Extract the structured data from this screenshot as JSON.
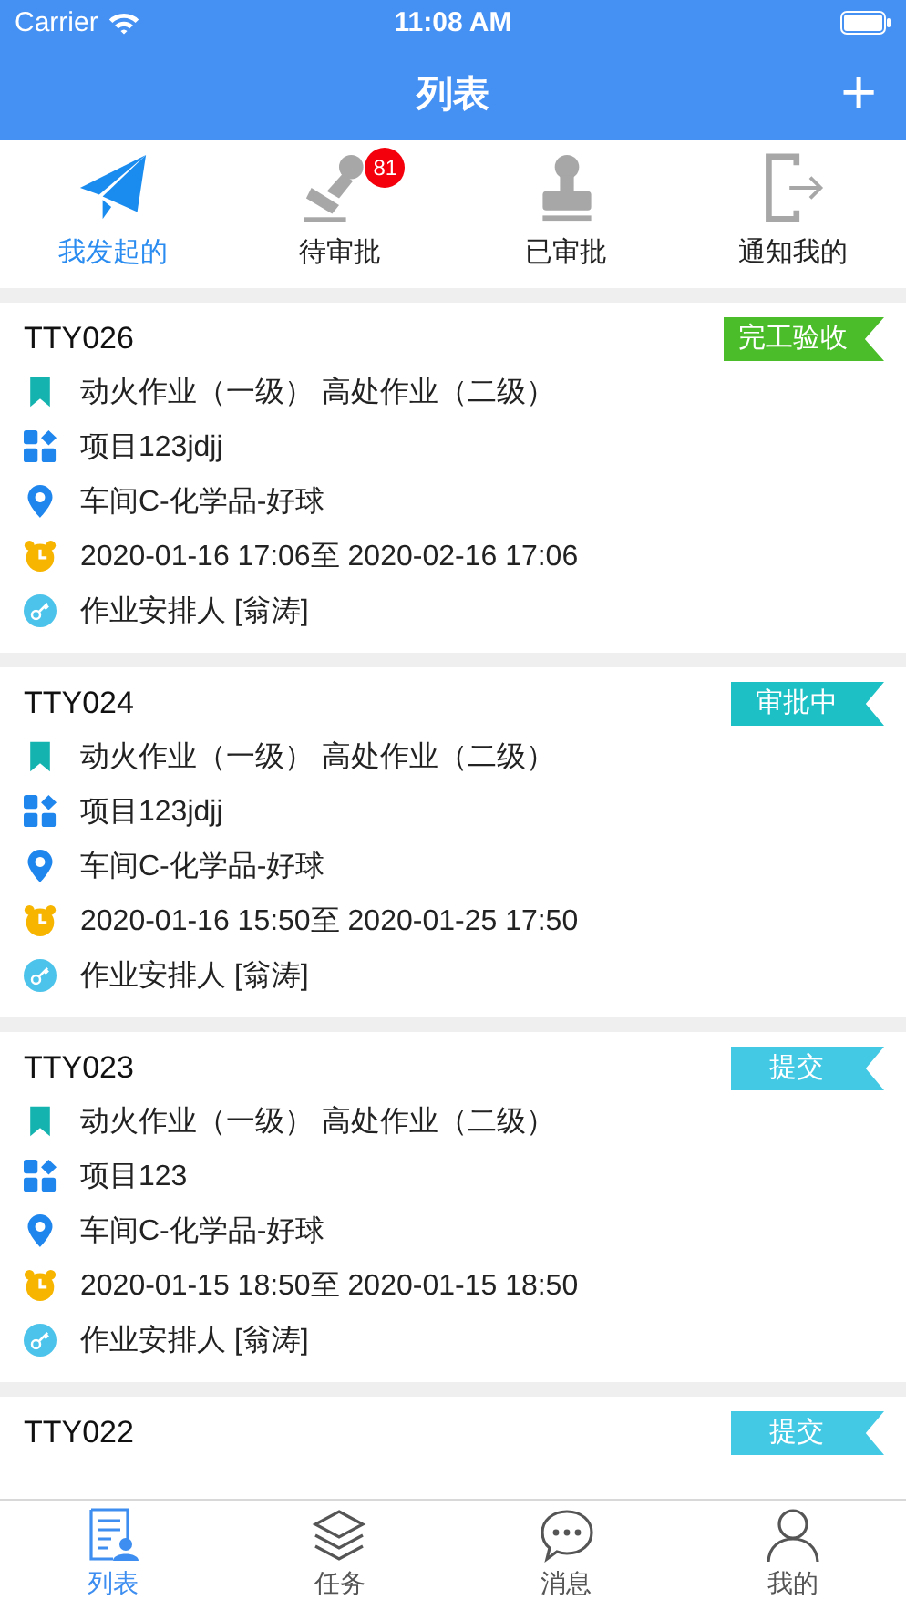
{
  "status_bar": {
    "carrier": "Carrier",
    "time": "11:08 AM"
  },
  "nav": {
    "title": "列表",
    "action": "+"
  },
  "tabs": [
    {
      "label": "我发起的",
      "kind": "plane",
      "selected": true
    },
    {
      "label": "待审批",
      "kind": "stamp-tilted",
      "selected": false,
      "badge": "81"
    },
    {
      "label": "已审批",
      "kind": "stamp",
      "selected": false
    },
    {
      "label": "通知我的",
      "kind": "exit",
      "selected": false
    }
  ],
  "cards": [
    {
      "code": "TTY026",
      "status": "完工验收",
      "color": "#4cbd2a",
      "rows": [
        {
          "kind": "type",
          "text": "动火作业（一级） 高处作业（二级）"
        },
        {
          "kind": "project",
          "text": "项目123jdjj"
        },
        {
          "kind": "location",
          "text": "车间C-化学品-好球"
        },
        {
          "kind": "time",
          "text": "2020-01-16 17:06至 2020-02-16 17:06"
        },
        {
          "kind": "person",
          "text": "作业安排人 [翁涛]"
        }
      ]
    },
    {
      "code": "TTY024",
      "status": "审批中",
      "color": "#1dc0c4",
      "rows": [
        {
          "kind": "type",
          "text": "动火作业（一级） 高处作业（二级）"
        },
        {
          "kind": "project",
          "text": "项目123jdjj"
        },
        {
          "kind": "location",
          "text": "车间C-化学品-好球"
        },
        {
          "kind": "time",
          "text": "2020-01-16 15:50至 2020-01-25 17:50"
        },
        {
          "kind": "person",
          "text": "作业安排人 [翁涛]"
        }
      ]
    },
    {
      "code": "TTY023",
      "status": "提交",
      "color": "#44c9e4",
      "rows": [
        {
          "kind": "type",
          "text": "动火作业（一级） 高处作业（二级）"
        },
        {
          "kind": "project",
          "text": "项目123"
        },
        {
          "kind": "location",
          "text": "车间C-化学品-好球"
        },
        {
          "kind": "time",
          "text": "2020-01-15 18:50至 2020-01-15 18:50"
        },
        {
          "kind": "person",
          "text": "作业安排人 [翁涛]"
        }
      ]
    },
    {
      "code": "TTY022",
      "status": "提交",
      "color": "#44c9e4"
    }
  ],
  "bottom_tabs": [
    {
      "label": "列表",
      "kind": "list",
      "selected": true
    },
    {
      "label": "任务",
      "kind": "layers",
      "selected": false
    },
    {
      "label": "消息",
      "kind": "chat",
      "selected": false
    },
    {
      "label": "我的",
      "kind": "user",
      "selected": false
    }
  ]
}
